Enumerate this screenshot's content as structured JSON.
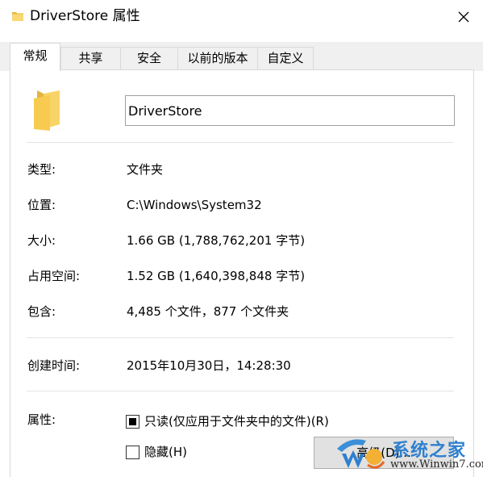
{
  "window": {
    "title": "DriverStore 属性"
  },
  "tabs": [
    {
      "label": "常规",
      "active": true
    },
    {
      "label": "共享",
      "active": false
    },
    {
      "label": "安全",
      "active": false
    },
    {
      "label": "以前的版本",
      "active": false
    },
    {
      "label": "自定义",
      "active": false
    }
  ],
  "general": {
    "name_value": "DriverStore",
    "type_label": "类型:",
    "type_value": "文件夹",
    "location_label": "位置:",
    "location_value": "C:\\Windows\\System32",
    "size_label": "大小:",
    "size_value": "1.66 GB (1,788,762,201 字节)",
    "disk_size_label": "占用空间:",
    "disk_size_value": "1.52 GB (1,640,398,848 字节)",
    "contains_label": "包含:",
    "contains_value": "4,485 个文件，877 个文件夹",
    "created_label": "创建时间:",
    "created_value": "2015年10月30日，14:28:30",
    "attributes_label": "属性:",
    "readonly_label": "只读(仅应用于文件夹中的文件)(R)",
    "readonly_state": "indeterminate",
    "hidden_label": "隐藏(H)",
    "hidden_checked": false,
    "advanced_button": "高级(D)..."
  },
  "watermark": {
    "brand": "系统之家",
    "url": "www.Winwin7.com"
  },
  "colors": {
    "folder": "#f5c542",
    "watermark_blue": "#2f7fcf"
  }
}
